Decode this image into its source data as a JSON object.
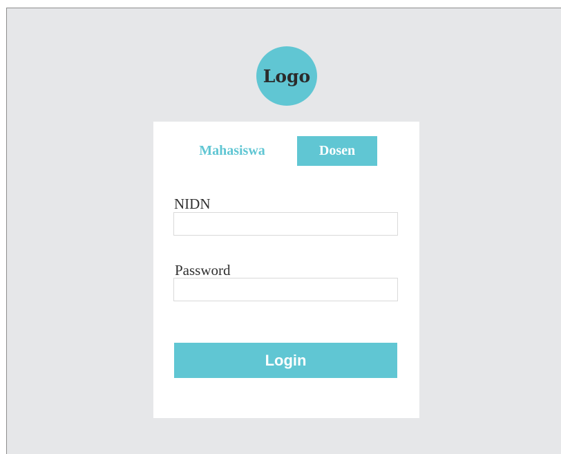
{
  "logo": {
    "text": "Logo"
  },
  "tabs": [
    {
      "label": "Mahasiswa",
      "active": false
    },
    {
      "label": "Dosen",
      "active": true
    }
  ],
  "form": {
    "nidn_label": "NIDN",
    "nidn_value": "",
    "password_label": "Password",
    "password_value": "",
    "login_label": "Login"
  },
  "colors": {
    "accent": "#60c6d3",
    "background": "#e6e7e9",
    "card": "#ffffff"
  }
}
